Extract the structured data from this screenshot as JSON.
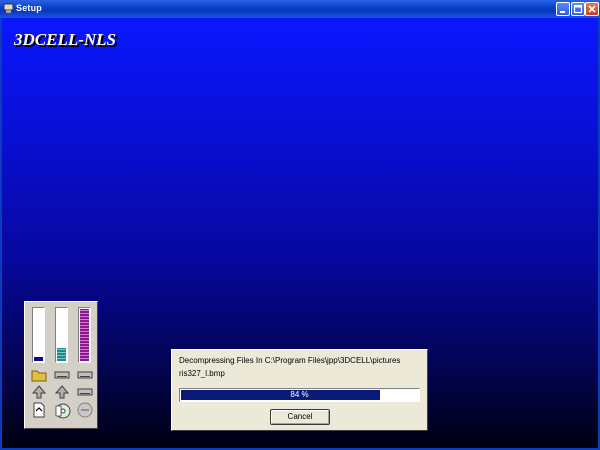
{
  "window": {
    "title": "Setup"
  },
  "app": {
    "title": "3DCELL-NLS"
  },
  "gauges": [
    {
      "name": "disk",
      "level": 0.08
    },
    {
      "name": "cd",
      "level": 0.25
    },
    {
      "name": "memory",
      "level": 1.0
    }
  ],
  "progress": {
    "line1": "Decompressing Files In C:\\Program Files\\jpp\\3DCELL\\pictures",
    "line2": "ris327_l.bmp",
    "percent": 84,
    "percent_label": "84 %",
    "cancel_label": "Cancel"
  },
  "colors": {
    "title_bar": "#0a3fc8",
    "background_top": "#0b16ff",
    "background_bottom": "#000012",
    "progress_fill": "#0a1a78",
    "dialog_bg": "#ece9d8"
  }
}
